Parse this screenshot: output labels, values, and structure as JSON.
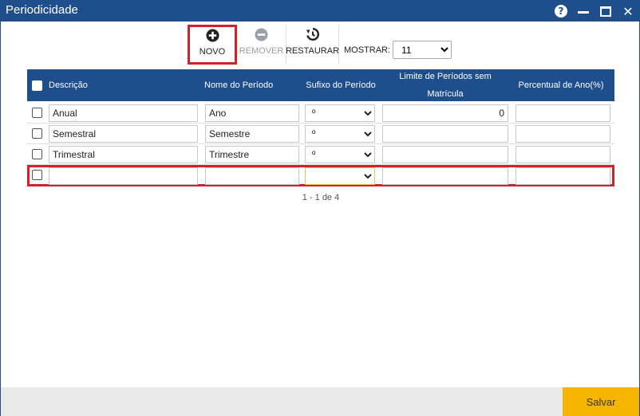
{
  "window": {
    "title": "Periodicidade",
    "help_glyph": "?"
  },
  "toolbar": {
    "novo_label": "NOVO",
    "remover_label": "REMOVER",
    "restaurar_label": "RESTAURAR",
    "mostrar_label": "MOSTRAR:",
    "mostrar_value": "11"
  },
  "grid": {
    "columns": [
      "Descrição",
      "Nome do Período",
      "Sufixo do Período",
      "Limite de Períodos sem Matrícula",
      "Percentual de Ano(%)"
    ],
    "rows": [
      {
        "descricao": "Anual",
        "nome": "Ano",
        "sufixo": "º",
        "limite": "0",
        "percentual": ""
      },
      {
        "descricao": "Semestral",
        "nome": "Semestre",
        "sufixo": "º",
        "limite": "",
        "percentual": ""
      },
      {
        "descricao": "Trimestral",
        "nome": "Trimestre",
        "sufixo": "º",
        "limite": "",
        "percentual": ""
      },
      {
        "descricao": "",
        "nome": "",
        "sufixo": "",
        "limite": "",
        "percentual": ""
      }
    ]
  },
  "pager": {
    "text": "1 - 1 de 4"
  },
  "footer": {
    "save_label": "Salvar"
  },
  "colors": {
    "header_blue": "#1f4e8c",
    "highlight_red": "#d62029",
    "save_yellow": "#f7b500"
  }
}
